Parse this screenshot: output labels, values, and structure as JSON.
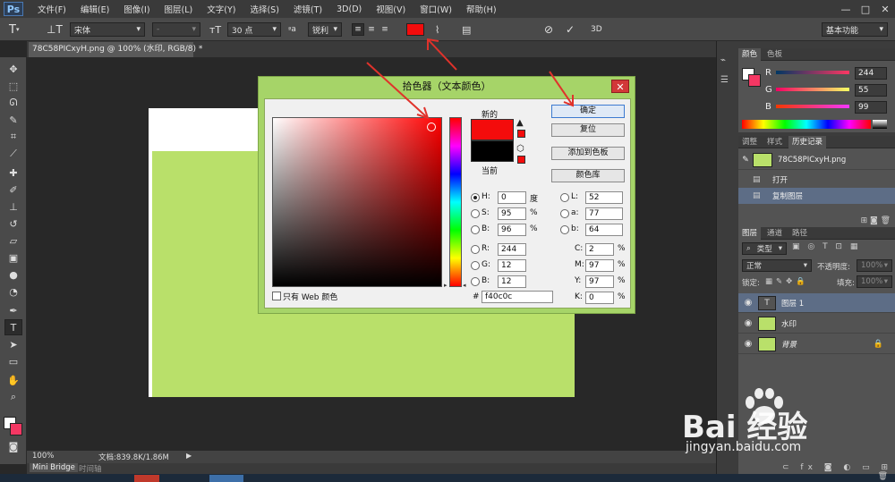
{
  "app": {
    "logo": "Ps"
  },
  "menu": [
    "文件(F)",
    "编辑(E)",
    "图像(I)",
    "图层(L)",
    "文字(Y)",
    "选择(S)",
    "滤镜(T)",
    "3D(D)",
    "视图(V)",
    "窗口(W)",
    "帮助(H)"
  ],
  "window_controls": [
    "—",
    "□",
    "✕"
  ],
  "options": {
    "font_family": "宋体",
    "font_style": "-",
    "font_size": "30 点",
    "aa_label": "a",
    "aa_value": "锐利",
    "text_color": "#f40c0c",
    "commit_3d": "3D",
    "workspace": "基本功能"
  },
  "document": {
    "tab_title": "78C58PICxyH.png @ 100% (水印, RGB/8) *",
    "zoom": "100%",
    "doc_size": "文档:839.8K/1.86M",
    "canvas_green": "#b9e06a"
  },
  "bottom_tabs": [
    "Mini Bridge",
    "时间轴"
  ],
  "color_panel": {
    "tabs": [
      "颜色",
      "色板"
    ],
    "r_label": "R",
    "g_label": "G",
    "b_label": "B",
    "r": "244",
    "g": "55",
    "b": "99"
  },
  "history_panel": {
    "tabs": [
      "调整",
      "样式",
      "历史记录"
    ],
    "snapshot": "78C58PICxyH.png",
    "items": [
      "打开",
      "复制图层"
    ]
  },
  "layers_panel": {
    "tabs": [
      "图层",
      "通道",
      "路径"
    ],
    "filter": "类型",
    "blend_mode": "正常",
    "opacity_label": "不透明度:",
    "opacity": "100%",
    "lock_label": "锁定:",
    "fill_label": "填充:",
    "fill": "100%",
    "layers": [
      {
        "name": "图层 1",
        "thumb": "T"
      },
      {
        "name": "水印",
        "thumb": ""
      },
      {
        "name": "背景",
        "thumb": ""
      }
    ]
  },
  "color_picker": {
    "title": "拾色器（文本颜色）",
    "close": "✕",
    "new_label": "新的",
    "current_label": "当前",
    "new_color": "#f40c0c",
    "current_color": "#000000",
    "buttons": {
      "ok": "确定",
      "reset": "复位",
      "add_swatch": "添加到色板",
      "libraries": "颜色库"
    },
    "web_only": "只有 Web 颜色",
    "hsb": {
      "h_label": "H:",
      "h": "0",
      "h_unit": "度",
      "s_label": "S:",
      "s": "95",
      "s_unit": "%",
      "b_label": "B:",
      "b": "96",
      "b_unit": "%"
    },
    "rgb": {
      "r_label": "R:",
      "r": "244",
      "g_label": "G:",
      "g": "12",
      "b_label": "B:",
      "b": "12"
    },
    "lab": {
      "l_label": "L:",
      "l": "52",
      "a_label": "a:",
      "a": "77",
      "b_label": "b:",
      "b": "64"
    },
    "cmyk": {
      "c_label": "C:",
      "c": "2",
      "m_label": "M:",
      "m": "97",
      "y_label": "Y:",
      "y": "97",
      "k_label": "K:",
      "k": "0",
      "unit": "%"
    },
    "hex_label": "#",
    "hex": "f40c0c"
  },
  "watermark": {
    "brand": "Bai 经验",
    "url": "jingyan.baidu.com"
  }
}
